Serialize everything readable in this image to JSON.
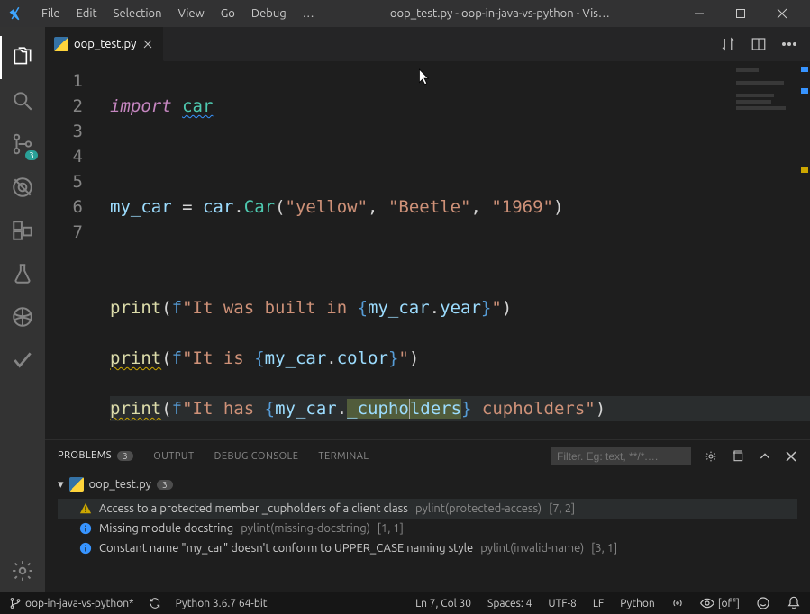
{
  "window": {
    "title": "oop_test.py - oop-in-java-vs-python - Vis…"
  },
  "menu": [
    "File",
    "Edit",
    "Selection",
    "View",
    "Go",
    "Debug",
    "…"
  ],
  "activitybar": {
    "scm_badge": "3"
  },
  "tab": {
    "filename": "oop_test.py"
  },
  "editor": {
    "line_numbers": [
      "1",
      "2",
      "3",
      "4",
      "5",
      "6",
      "7"
    ],
    "l1_kw": "import",
    "l1_mod": "car",
    "l3_var": "my_car",
    "l3_eq": " = ",
    "l3_mod": "car",
    "l3_dot": ".",
    "l3_cls": "Car",
    "l3_open": "(",
    "l3_s1": "\"yellow\"",
    "l3_c": ", ",
    "l3_s2": "\"Beetle\"",
    "l3_s3": "\"1969\"",
    "l3_close": ")",
    "l5_fn": "print",
    "l5_open": "(",
    "l5_f": "f",
    "l5_str_a": "\"It was built in ",
    "l5_lb": "{",
    "l5_var": "my_car",
    "l5_dot": ".",
    "l5_attr": "year",
    "l5_rb": "}",
    "l5_str_b": "\"",
    "l5_close": ")",
    "l6_str_a": "\"It is ",
    "l6_attr": "color",
    "l7_str_a": "\"It has ",
    "l7_attr": "_cupholders",
    "l7_sel_a": "_cupho",
    "l7_sel_b": "lders",
    "l7_str_b": " cupholders\""
  },
  "panel": {
    "tabs": {
      "problems": "PROBLEMS",
      "output": "OUTPUT",
      "debug": "DEBUG CONSOLE",
      "terminal": "TERMINAL"
    },
    "problems_badge": "3",
    "filter_placeholder": "Filter. Eg: text, **/*.…",
    "file": "oop_test.py",
    "file_count": "3",
    "items": [
      {
        "sev": "warning",
        "msg": "Access to a protected member _cupholders of a client class",
        "src": "pylint(protected-access)",
        "loc": "[7, 2]"
      },
      {
        "sev": "info",
        "msg": "Missing module docstring",
        "src": "pylint(missing-docstring)",
        "loc": "[1, 1]"
      },
      {
        "sev": "info",
        "msg": "Constant name \"my_car\" doesn't conform to UPPER_CASE naming style",
        "src": "pylint(invalid-name)",
        "loc": "[3, 1]"
      }
    ]
  },
  "statusbar": {
    "branch": "oop-in-java-vs-python*",
    "python": "Python 3.6.7 64-bit",
    "pos": "Ln 7, Col 30",
    "spaces": "Spaces: 4",
    "encoding": "UTF-8",
    "eol": "LF",
    "lang": "Python",
    "preview": "[off]"
  }
}
